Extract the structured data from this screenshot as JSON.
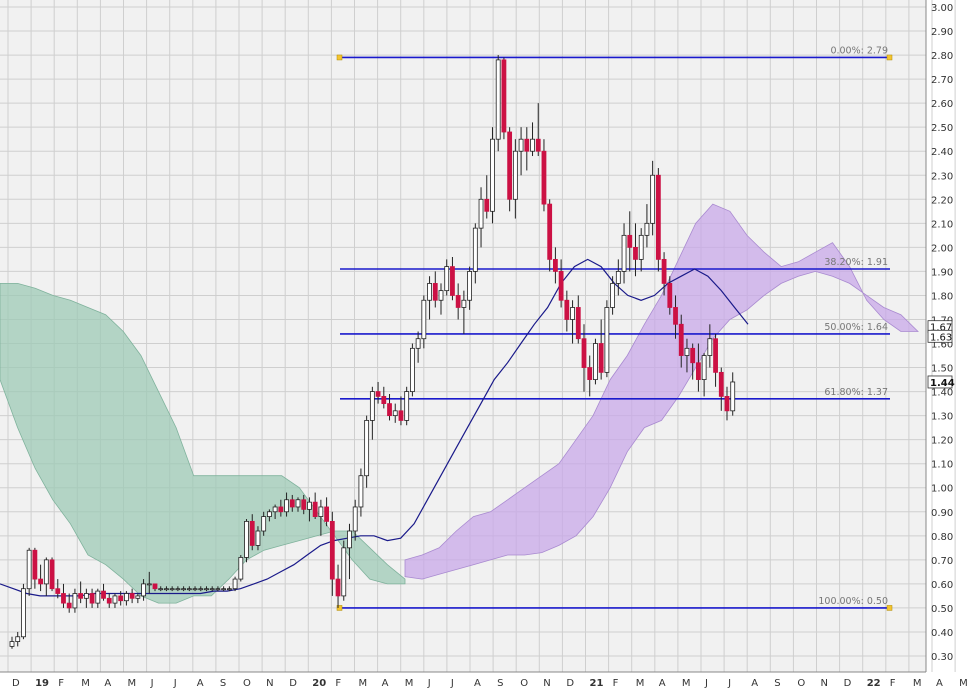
{
  "chart_data": {
    "type": "candlestick",
    "x_ticks": [
      "D",
      "19",
      "F",
      "M",
      "A",
      "M",
      "J",
      "J",
      "A",
      "S",
      "O",
      "N",
      "D",
      "20",
      "F",
      "M",
      "A",
      "M",
      "J",
      "J",
      "A",
      "S",
      "O",
      "N",
      "D",
      "21",
      "F",
      "M",
      "A",
      "M",
      "J",
      "J",
      "A",
      "S",
      "O",
      "N",
      "D",
      "22",
      "F",
      "M",
      "A",
      "M"
    ],
    "y_ticks": [
      "0.30",
      "0.40",
      "0.50",
      "0.60",
      "0.70",
      "0.80",
      "0.90",
      "1.00",
      "1.10",
      "1.20",
      "1.30",
      "1.40",
      "1.50",
      "1.60",
      "1.70",
      "1.80",
      "1.90",
      "2.00",
      "2.10",
      "2.20",
      "2.30",
      "2.40",
      "2.50",
      "2.60",
      "2.70",
      "2.80",
      "2.90",
      "3.00"
    ],
    "ylim": [
      0.28,
      3.02
    ],
    "price_badges": [
      {
        "text": "1.67",
        "value": 1.67
      },
      {
        "text": "1.63",
        "value": 1.63
      },
      {
        "text": "1.44",
        "value": 1.44
      }
    ],
    "fib_levels": [
      {
        "label": "0.00%: 2.79",
        "value": 2.79
      },
      {
        "label": "38.20%: 1.91",
        "value": 1.91
      },
      {
        "label": "50.00%: 1.64",
        "value": 1.64
      },
      {
        "label": "61.80%: 1.37",
        "value": 1.37
      },
      {
        "label": "100.00%: 0.50",
        "value": 0.5
      }
    ],
    "candles": [
      [
        0.34,
        0.38,
        0.33,
        0.36
      ],
      [
        0.36,
        0.4,
        0.34,
        0.38
      ],
      [
        0.38,
        0.6,
        0.37,
        0.58
      ],
      [
        0.58,
        0.75,
        0.55,
        0.74
      ],
      [
        0.74,
        0.75,
        0.58,
        0.62
      ],
      [
        0.62,
        0.68,
        0.57,
        0.6
      ],
      [
        0.6,
        0.71,
        0.55,
        0.7
      ],
      [
        0.7,
        0.71,
        0.57,
        0.58
      ],
      [
        0.58,
        0.62,
        0.54,
        0.56
      ],
      [
        0.56,
        0.6,
        0.5,
        0.52
      ],
      [
        0.52,
        0.56,
        0.48,
        0.5
      ],
      [
        0.5,
        0.58,
        0.48,
        0.56
      ],
      [
        0.56,
        0.61,
        0.52,
        0.54
      ],
      [
        0.54,
        0.58,
        0.5,
        0.56
      ],
      [
        0.56,
        0.58,
        0.5,
        0.52
      ],
      [
        0.52,
        0.58,
        0.5,
        0.57
      ],
      [
        0.57,
        0.6,
        0.53,
        0.54
      ],
      [
        0.54,
        0.56,
        0.5,
        0.52
      ],
      [
        0.52,
        0.56,
        0.5,
        0.55
      ],
      [
        0.55,
        0.57,
        0.51,
        0.53
      ],
      [
        0.53,
        0.57,
        0.51,
        0.56
      ],
      [
        0.56,
        0.58,
        0.52,
        0.54
      ],
      [
        0.54,
        0.56,
        0.52,
        0.55
      ],
      [
        0.55,
        0.62,
        0.53,
        0.6
      ],
      [
        0.6,
        0.65,
        0.56,
        0.6
      ],
      [
        0.6,
        0.6,
        0.57,
        0.58
      ],
      [
        0.58,
        0.59,
        0.57,
        0.58
      ],
      [
        0.58,
        0.59,
        0.57,
        0.58
      ],
      [
        0.58,
        0.59,
        0.57,
        0.58
      ],
      [
        0.58,
        0.59,
        0.57,
        0.58
      ],
      [
        0.58,
        0.59,
        0.57,
        0.58
      ],
      [
        0.58,
        0.59,
        0.57,
        0.58
      ],
      [
        0.58,
        0.59,
        0.57,
        0.58
      ],
      [
        0.58,
        0.59,
        0.57,
        0.58
      ],
      [
        0.58,
        0.59,
        0.57,
        0.58
      ],
      [
        0.58,
        0.59,
        0.57,
        0.58
      ],
      [
        0.58,
        0.59,
        0.57,
        0.58
      ],
      [
        0.58,
        0.59,
        0.57,
        0.58
      ],
      [
        0.58,
        0.59,
        0.57,
        0.58
      ],
      [
        0.58,
        0.63,
        0.57,
        0.62
      ],
      [
        0.62,
        0.72,
        0.61,
        0.71
      ],
      [
        0.71,
        0.87,
        0.69,
        0.86
      ],
      [
        0.86,
        0.89,
        0.74,
        0.76
      ],
      [
        0.76,
        0.84,
        0.74,
        0.82
      ],
      [
        0.82,
        0.9,
        0.8,
        0.88
      ],
      [
        0.88,
        0.91,
        0.86,
        0.9
      ],
      [
        0.9,
        0.93,
        0.87,
        0.92
      ],
      [
        0.92,
        0.95,
        0.88,
        0.9
      ],
      [
        0.9,
        0.98,
        0.88,
        0.95
      ],
      [
        0.95,
        0.97,
        0.9,
        0.92
      ],
      [
        0.92,
        0.96,
        0.9,
        0.95
      ],
      [
        0.95,
        0.97,
        0.89,
        0.91
      ],
      [
        0.91,
        0.96,
        0.86,
        0.94
      ],
      [
        0.94,
        0.98,
        0.87,
        0.88
      ],
      [
        0.88,
        0.95,
        0.8,
        0.92
      ],
      [
        0.92,
        0.96,
        0.84,
        0.86
      ],
      [
        0.86,
        0.9,
        0.55,
        0.62
      ],
      [
        0.62,
        0.68,
        0.5,
        0.55
      ],
      [
        0.55,
        0.78,
        0.53,
        0.75
      ],
      [
        0.75,
        0.85,
        0.62,
        0.82
      ],
      [
        0.82,
        0.95,
        0.78,
        0.92
      ],
      [
        0.92,
        1.08,
        0.88,
        1.05
      ],
      [
        1.05,
        1.3,
        1.0,
        1.28
      ],
      [
        1.28,
        1.42,
        1.2,
        1.4
      ],
      [
        1.4,
        1.44,
        1.35,
        1.38
      ],
      [
        1.38,
        1.42,
        1.33,
        1.35
      ],
      [
        1.35,
        1.39,
        1.28,
        1.3
      ],
      [
        1.3,
        1.35,
        1.27,
        1.32
      ],
      [
        1.32,
        1.38,
        1.26,
        1.28
      ],
      [
        1.28,
        1.42,
        1.26,
        1.4
      ],
      [
        1.4,
        1.6,
        1.38,
        1.58
      ],
      [
        1.58,
        1.65,
        1.52,
        1.62
      ],
      [
        1.62,
        1.8,
        1.58,
        1.78
      ],
      [
        1.78,
        1.88,
        1.7,
        1.85
      ],
      [
        1.85,
        1.9,
        1.75,
        1.78
      ],
      [
        1.78,
        1.85,
        1.72,
        1.82
      ],
      [
        1.82,
        1.95,
        1.8,
        1.92
      ],
      [
        1.92,
        1.96,
        1.78,
        1.8
      ],
      [
        1.8,
        1.85,
        1.7,
        1.75
      ],
      [
        1.75,
        1.82,
        1.64,
        1.78
      ],
      [
        1.78,
        1.92,
        1.74,
        1.9
      ],
      [
        1.9,
        2.1,
        1.85,
        2.08
      ],
      [
        2.08,
        2.25,
        2.0,
        2.2
      ],
      [
        2.2,
        2.3,
        2.12,
        2.15
      ],
      [
        2.15,
        2.5,
        2.1,
        2.45
      ],
      [
        2.45,
        2.8,
        2.4,
        2.78
      ],
      [
        2.78,
        2.79,
        2.45,
        2.48
      ],
      [
        2.48,
        2.5,
        2.15,
        2.2
      ],
      [
        2.2,
        2.45,
        2.12,
        2.4
      ],
      [
        2.4,
        2.5,
        2.3,
        2.45
      ],
      [
        2.45,
        2.5,
        2.32,
        2.4
      ],
      [
        2.4,
        2.52,
        2.38,
        2.45
      ],
      [
        2.45,
        2.6,
        2.38,
        2.4
      ],
      [
        2.4,
        2.45,
        2.15,
        2.18
      ],
      [
        2.18,
        2.2,
        1.9,
        1.95
      ],
      [
        1.95,
        2.0,
        1.85,
        1.9
      ],
      [
        1.9,
        1.95,
        1.75,
        1.78
      ],
      [
        1.78,
        1.82,
        1.65,
        1.7
      ],
      [
        1.7,
        1.78,
        1.6,
        1.75
      ],
      [
        1.75,
        1.8,
        1.6,
        1.62
      ],
      [
        1.62,
        1.68,
        1.4,
        1.5
      ],
      [
        1.5,
        1.55,
        1.38,
        1.45
      ],
      [
        1.45,
        1.62,
        1.43,
        1.6
      ],
      [
        1.6,
        1.7,
        1.45,
        1.48
      ],
      [
        1.48,
        1.78,
        1.46,
        1.75
      ],
      [
        1.75,
        1.88,
        1.72,
        1.85
      ],
      [
        1.85,
        1.95,
        1.8,
        1.9
      ],
      [
        1.9,
        2.1,
        1.85,
        2.05
      ],
      [
        2.05,
        2.15,
        1.9,
        2.0
      ],
      [
        2.0,
        2.1,
        1.88,
        1.95
      ],
      [
        1.95,
        2.08,
        1.9,
        2.05
      ],
      [
        2.05,
        2.18,
        2.0,
        2.1
      ],
      [
        2.1,
        2.36,
        2.05,
        2.3
      ],
      [
        2.3,
        2.33,
        1.9,
        1.95
      ],
      [
        1.95,
        1.98,
        1.8,
        1.85
      ],
      [
        1.85,
        1.88,
        1.72,
        1.75
      ],
      [
        1.75,
        1.8,
        1.62,
        1.68
      ],
      [
        1.68,
        1.72,
        1.5,
        1.55
      ],
      [
        1.55,
        1.62,
        1.48,
        1.58
      ],
      [
        1.58,
        1.6,
        1.45,
        1.52
      ],
      [
        1.52,
        1.6,
        1.4,
        1.45
      ],
      [
        1.45,
        1.56,
        1.38,
        1.55
      ],
      [
        1.55,
        1.68,
        1.5,
        1.62
      ],
      [
        1.62,
        1.64,
        1.42,
        1.48
      ],
      [
        1.48,
        1.5,
        1.32,
        1.38
      ],
      [
        1.38,
        1.42,
        1.28,
        1.32
      ],
      [
        1.32,
        1.48,
        1.3,
        1.44
      ]
    ],
    "ma_line": [
      0.6,
      0.58,
      0.56,
      0.55,
      0.55,
      0.55,
      0.55,
      0.56,
      0.56,
      0.56,
      0.56,
      0.56,
      0.56,
      0.56,
      0.56,
      0.56,
      0.57,
      0.57,
      0.58,
      0.6,
      0.62,
      0.65,
      0.68,
      0.72,
      0.76,
      0.78,
      0.79,
      0.8,
      0.8,
      0.78,
      0.79,
      0.85,
      0.95,
      1.05,
      1.15,
      1.25,
      1.35,
      1.45,
      1.52,
      1.6,
      1.68,
      1.75,
      1.85,
      1.92,
      1.95,
      1.92,
      1.85,
      1.8,
      1.78,
      1.8,
      1.85,
      1.88,
      1.91,
      1.88,
      1.82,
      1.75,
      1.68
    ],
    "cloud_green": {
      "upper": [
        1.85,
        1.85,
        1.83,
        1.8,
        1.78,
        1.75,
        1.72,
        1.65,
        1.55,
        1.4,
        1.25,
        1.05,
        1.05,
        1.05,
        1.05,
        1.05,
        1.05,
        1.0,
        0.9,
        0.8,
        0.7,
        0.62,
        0.6,
        0.6
      ],
      "lower": [
        1.45,
        1.25,
        1.08,
        0.95,
        0.85,
        0.72,
        0.68,
        0.62,
        0.55,
        0.52,
        0.52,
        0.55,
        0.55,
        0.62,
        0.7,
        0.74,
        0.76,
        0.78,
        0.8,
        0.82,
        0.82,
        0.75,
        0.68,
        0.62
      ]
    },
    "cloud_purple": {
      "upper": [
        0.7,
        0.72,
        0.75,
        0.82,
        0.88,
        0.9,
        0.95,
        1.0,
        1.05,
        1.1,
        1.2,
        1.3,
        1.45,
        1.55,
        1.68,
        1.8,
        1.95,
        2.1,
        2.18,
        2.15,
        2.05,
        1.98,
        1.92,
        1.94,
        1.98,
        2.02,
        1.92,
        1.78,
        1.7,
        1.65,
        1.65
      ],
      "lower": [
        0.63,
        0.62,
        0.64,
        0.66,
        0.68,
        0.7,
        0.72,
        0.72,
        0.73,
        0.76,
        0.8,
        0.88,
        1.0,
        1.15,
        1.25,
        1.28,
        1.38,
        1.5,
        1.62,
        1.7,
        1.74,
        1.8,
        1.85,
        1.88,
        1.9,
        1.88,
        1.85,
        1.8,
        1.75,
        1.72,
        1.65
      ]
    },
    "colors": {
      "bull_fill": "#ffffff",
      "bear_fill": "#cc1144",
      "wick": "#222222",
      "fib_line": "#1a1acc",
      "ma": "#1a1a8a",
      "cloud_green": "#9ec9b6",
      "cloud_purple": "#c8a8e8",
      "grid": "#cfcfcf",
      "plot_bg": "#f1f1f1"
    }
  }
}
